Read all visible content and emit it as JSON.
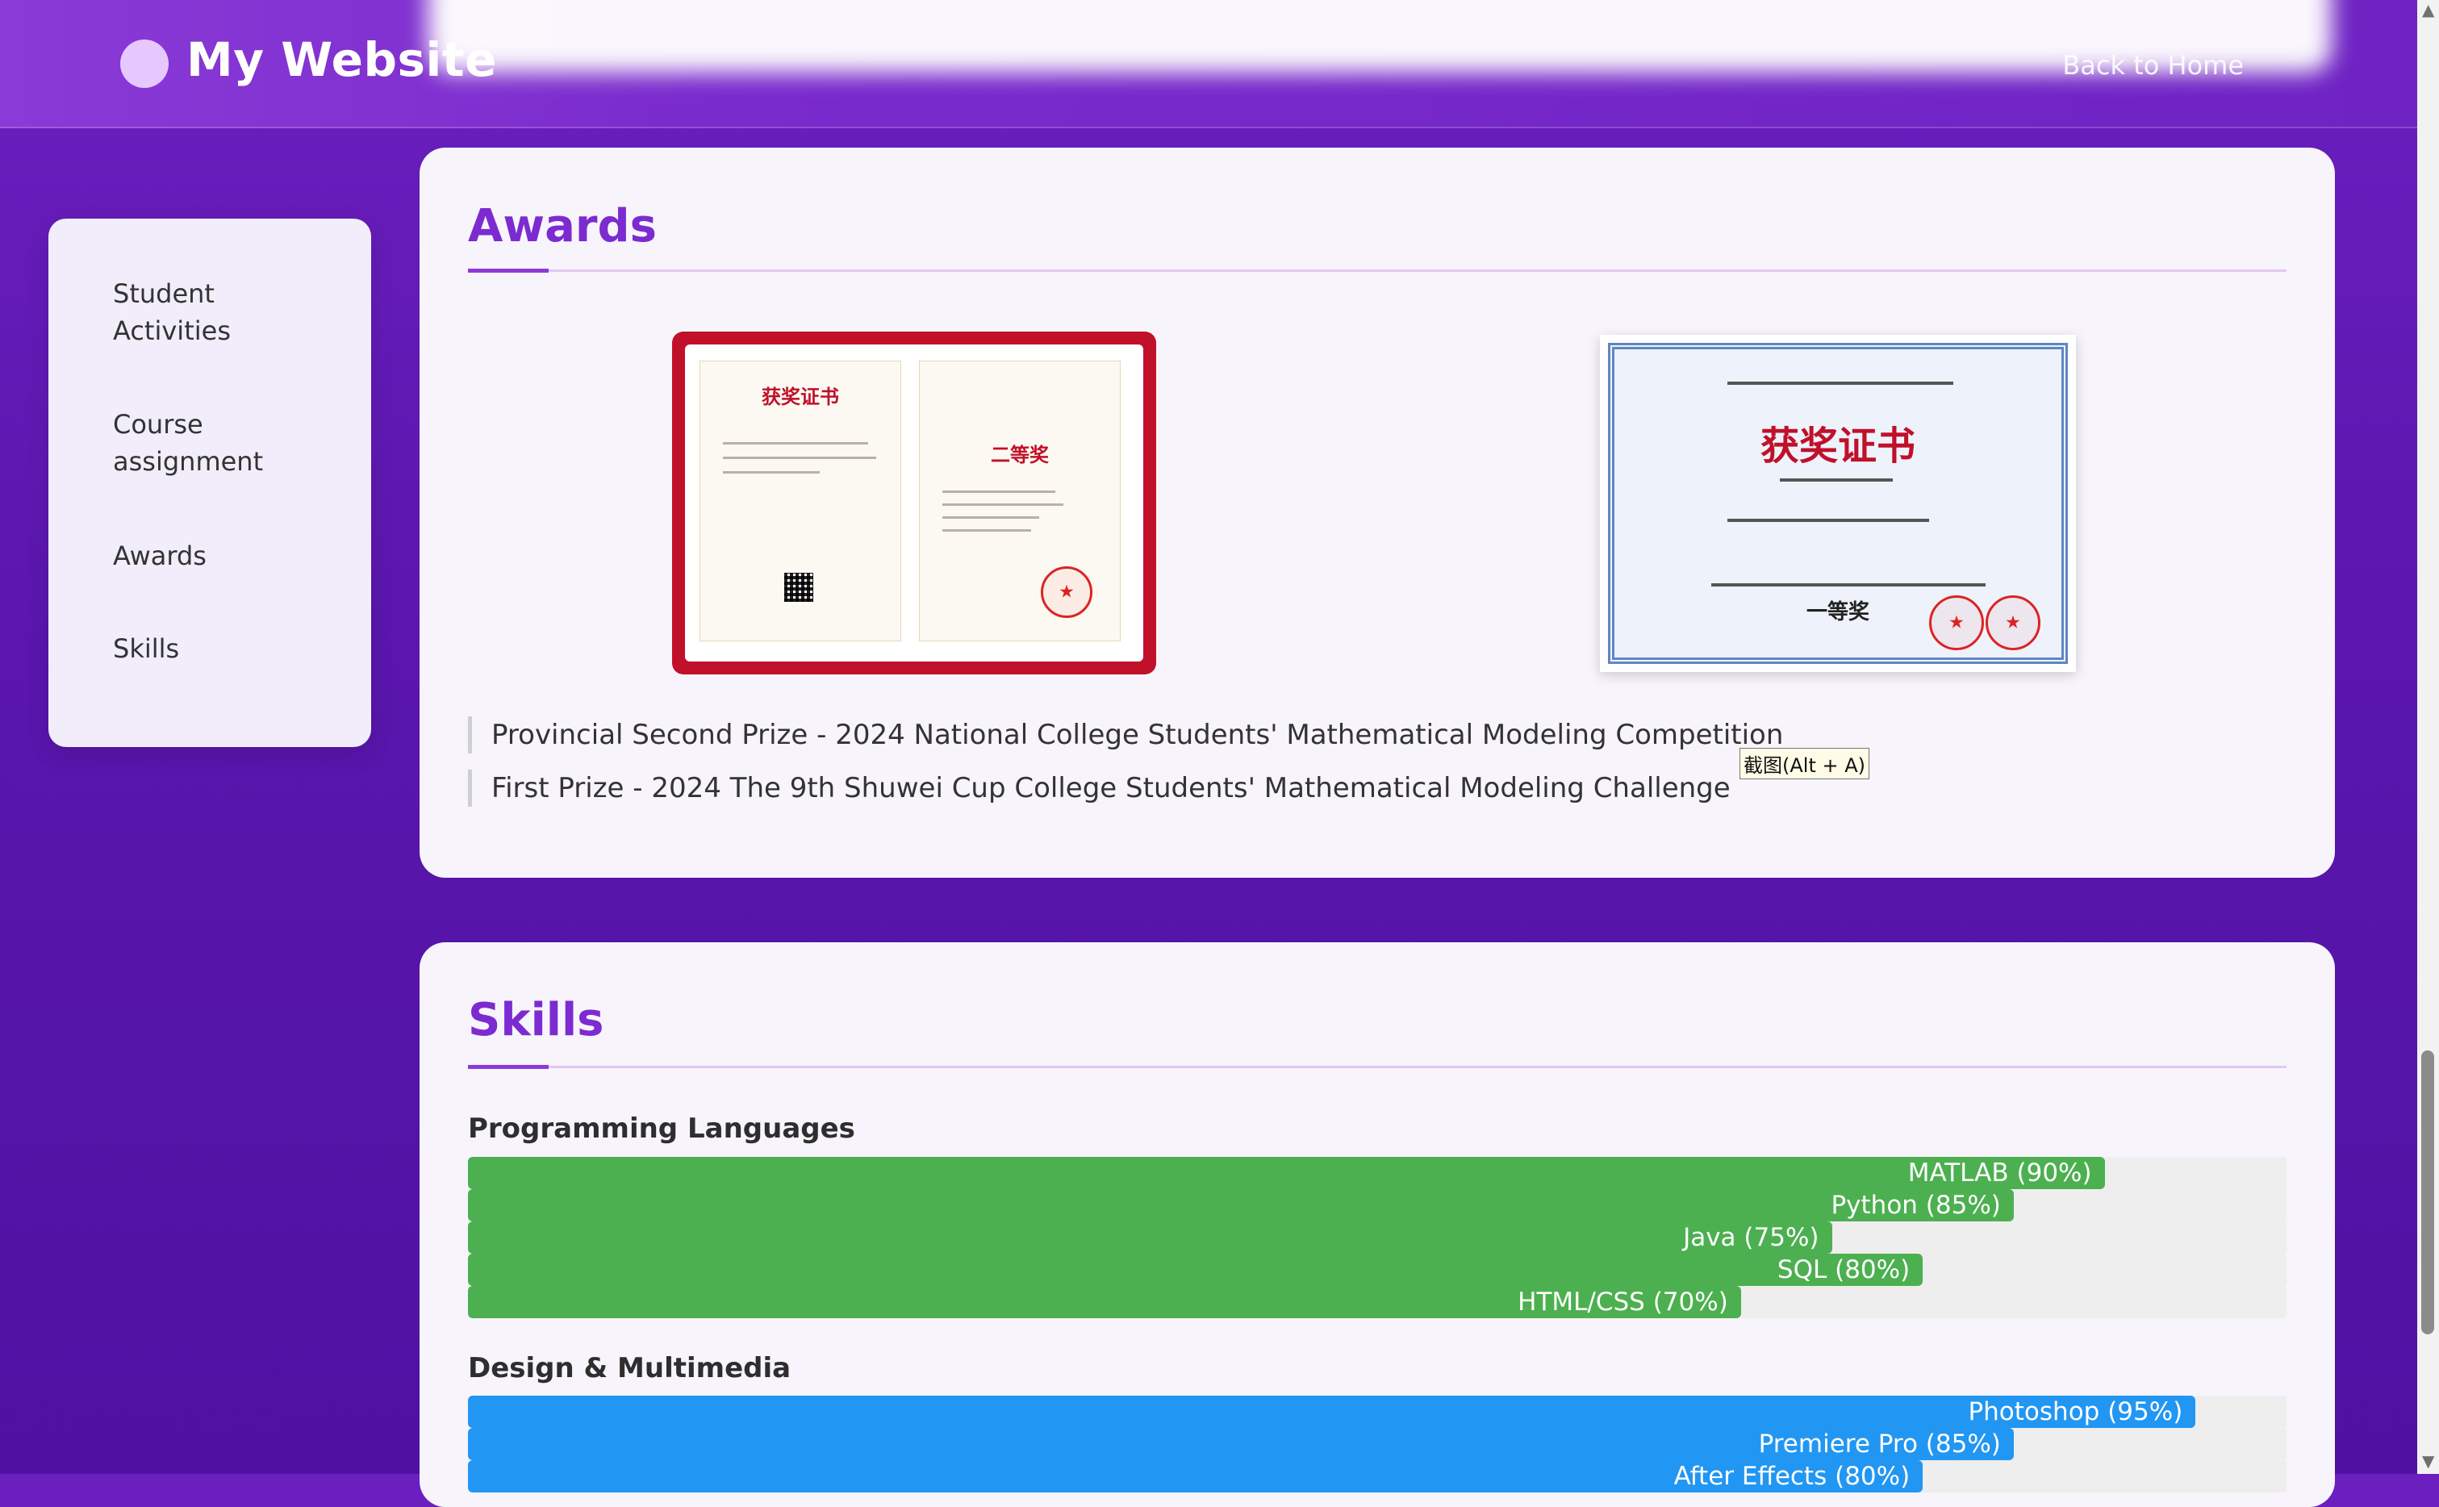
{
  "header": {
    "site_title": "My Website",
    "back_home": "Back to Home"
  },
  "sidebar": {
    "items": [
      {
        "label": "Student\nActivities"
      },
      {
        "label": "Course\nassignment"
      },
      {
        "label": "Awards"
      },
      {
        "label": "Skills"
      }
    ]
  },
  "awards": {
    "title": "Awards",
    "certificates": [
      {
        "name": "certificate-provincial-second-prize",
        "header": "获奖证书",
        "prize": "二等奖"
      },
      {
        "name": "certificate-shuwei-first-prize",
        "header": "获奖证书",
        "prize": "一等奖"
      }
    ],
    "items": [
      "Provincial Second Prize - 2024 National College Students' Mathematical Modeling Competition",
      "First Prize - 2024 The 9th Shuwei Cup College Students' Mathematical Modeling Challenge"
    ]
  },
  "screenshot_tip": "截图(Alt + A)",
  "skills": {
    "title": "Skills",
    "groups": [
      {
        "title": "Programming Languages",
        "color": "#4caf50",
        "items": [
          {
            "label": "MATLAB (90%)",
            "level": 0.9
          },
          {
            "label": "Python (85%)",
            "level": 0.85
          },
          {
            "label": "Java (75%)",
            "level": 0.75
          },
          {
            "label": "SQL (80%)",
            "level": 0.8
          },
          {
            "label": "HTML/CSS (70%)",
            "level": 0.7
          }
        ]
      },
      {
        "title": "Design & Multimedia",
        "color": "#2196f3",
        "items": [
          {
            "label": "Photoshop (95%)",
            "level": 0.95
          },
          {
            "label": "Premiere Pro (85%)",
            "level": 0.85
          },
          {
            "label": "After Effects (80%)",
            "level": 0.8
          }
        ]
      }
    ]
  }
}
